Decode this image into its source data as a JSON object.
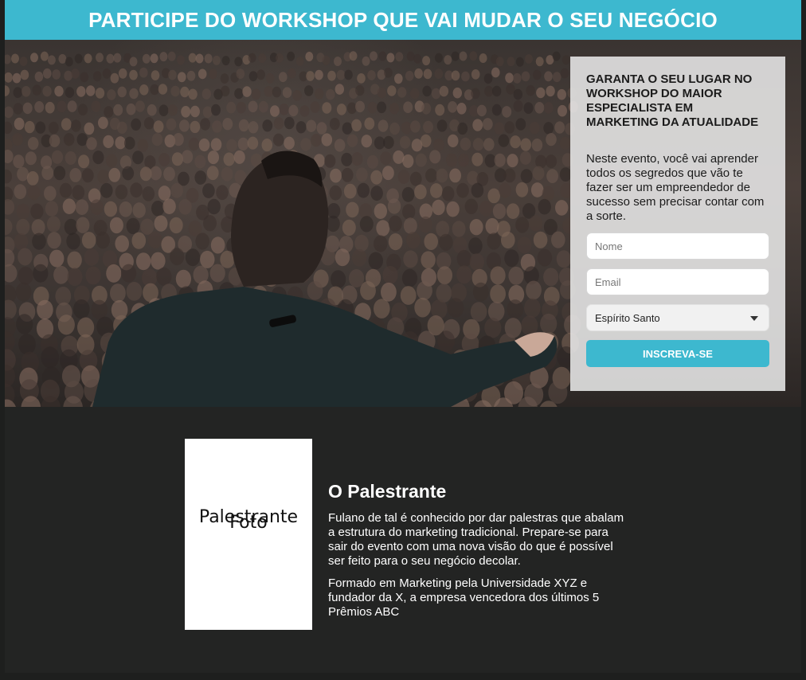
{
  "banner": {
    "title": "PARTICIPE DO WORKSHOP QUE VAI MUDAR O SEU NEGÓCIO"
  },
  "signup": {
    "heading": "GARANTA O SEU LUGAR NO WORKSHOP DO MAIOR ESPECIALISTA EM MARKETING DA ATUALIDADE",
    "description": "Neste evento, você vai aprender todos os segredos que vão te fazer ser um empreendedor de sucesso sem precisar contar com a sorte.",
    "name_placeholder": "Nome",
    "email_placeholder": "Email",
    "state_selected": "Espírito Santo",
    "submit_label": "INSCREVA-SE"
  },
  "speaker": {
    "photo_label_line1": "Foto",
    "photo_label_line2": "Palestrante",
    "title": "O Palestrante",
    "bio_1": "Fulano de tal é conhecido por dar palestras que abalam a estrutura do marketing tradicional. Prepare-se para sair do evento com uma nova visão do que é possível ser feito para o seu negócio decolar.",
    "bio_2": "Formado em Marketing pela Universidade XYZ e fundador da X, a empresa vencedora dos últimos 5 Prêmios ABC"
  },
  "colors": {
    "accent": "#3db8cf",
    "dark_background": "#232423"
  }
}
